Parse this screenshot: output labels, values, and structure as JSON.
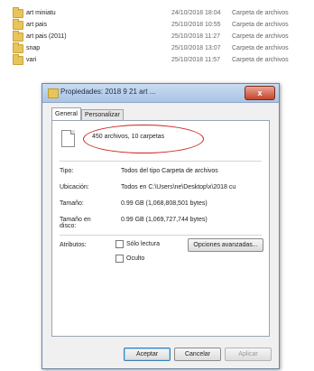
{
  "file_list": [
    {
      "name": "art miniatu",
      "date": "24/10/2018 18:04",
      "type": "Carpeta de archivos"
    },
    {
      "name": "art pais",
      "date": "25/10/2018 10:55",
      "type": "Carpeta de archivos"
    },
    {
      "name": "art pais (2011)",
      "date": "25/10/2018 11:27",
      "type": "Carpeta de archivos"
    },
    {
      "name": "snap",
      "date": "25/10/2018 13:07",
      "type": "Carpeta de archivos"
    },
    {
      "name": "vari",
      "date": "25/10/2018 11:57",
      "type": "Carpeta de archivos"
    }
  ],
  "dialog": {
    "title": "Propiedades: 2018 9 21 art ...",
    "close_label": "x",
    "tabs": [
      "General",
      "Personalizar"
    ],
    "count_text": "450 archivos, 10 carpetas",
    "fields": {
      "tipo_label": "Tipo:",
      "tipo_value": "Todos del tipo Carpeta de archivos",
      "ubicacion_label": "Ubicación:",
      "ubicacion_value": "Todos en C:\\Users\\ne\\Desktop\\x\\2018 cu",
      "tamano_label": "Tamaño:",
      "tamano_value": "0.99 GB (1,068,808,501 bytes)",
      "tamano_disco_label": "Tamaño en disco:",
      "tamano_disco_value": "0.99 GB (1,069,727,744 bytes)",
      "atributos_label": "Atributos:"
    },
    "solo_lectura_label": "Sólo lectura",
    "oculto_label": "Oculto",
    "opciones_label": "Opciones avanzadas...",
    "buttons": {
      "aceptar": "Aceptar",
      "cancelar": "Cancelar",
      "aplicar": "Aplicar"
    }
  }
}
